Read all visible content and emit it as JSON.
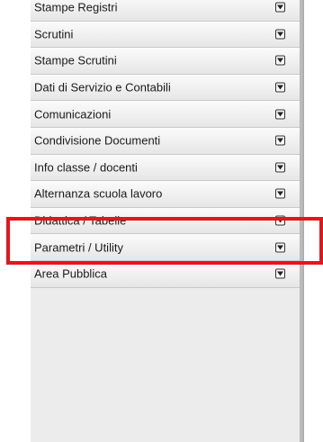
{
  "menu": {
    "items": [
      {
        "label": "Stampe Registri"
      },
      {
        "label": "Scrutini"
      },
      {
        "label": "Stampe Scrutini"
      },
      {
        "label": "Dati di Servizio e Contabili"
      },
      {
        "label": "Comunicazioni"
      },
      {
        "label": "Condivisione Documenti"
      },
      {
        "label": "Info classe / docenti"
      },
      {
        "label": "Alternanza scuola lavoro"
      },
      {
        "label": "Didattica / Tabelle"
      },
      {
        "label": "Parametri / Utility"
      },
      {
        "label": "Area Pubblica"
      }
    ],
    "toggle_icon": "chevron-down-icon",
    "highlighted_item": "Info classe / docenti"
  },
  "colors": {
    "highlight": "#e8141b",
    "panel": "#ececec",
    "text": "#1a1a1a"
  }
}
